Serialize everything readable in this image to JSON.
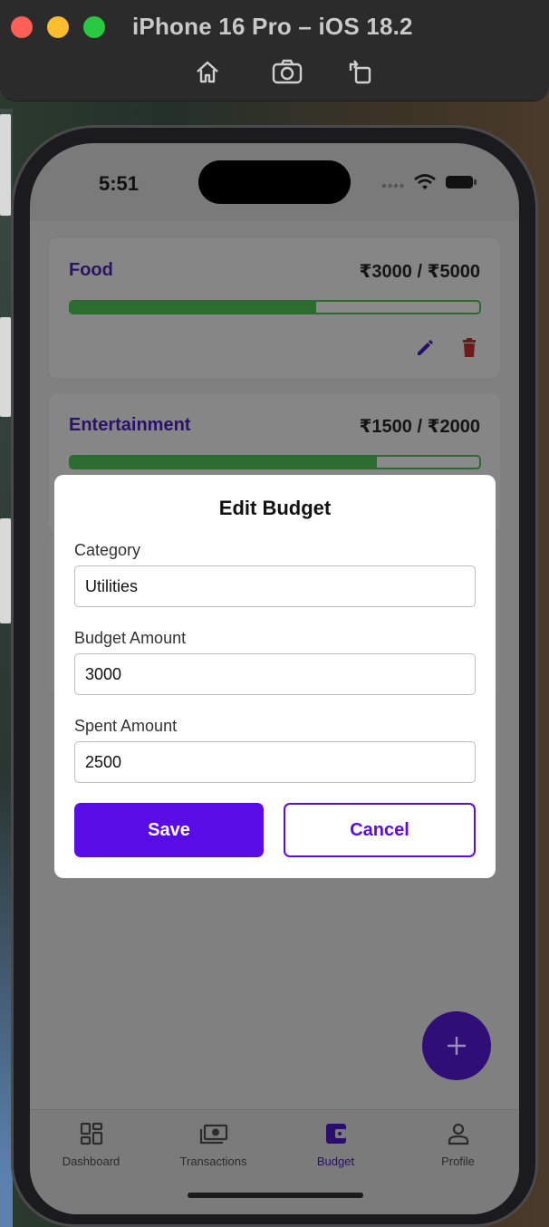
{
  "simulator": {
    "title": "iPhone 16 Pro – iOS 18.2",
    "toolbar": [
      "home-icon",
      "screenshot-icon",
      "rotate-icon"
    ]
  },
  "status_bar": {
    "time": "5:51"
  },
  "budgets": [
    {
      "category": "Food",
      "amount_text": "₹3000 / ₹5000",
      "spent": 3000,
      "budget": 5000,
      "progress": 0.6
    },
    {
      "category": "Entertainment",
      "amount_text": "₹1500 / ₹2000",
      "spent": 1500,
      "budget": 2000,
      "progress": 0.75
    }
  ],
  "modal": {
    "title": "Edit Budget",
    "category_label": "Category",
    "category_value": "Utilities",
    "budget_label": "Budget Amount",
    "budget_value": "3000",
    "spent_label": "Spent Amount",
    "spent_value": "2500",
    "save_label": "Save",
    "cancel_label": "Cancel"
  },
  "fab": {
    "label": "+"
  },
  "tabs": [
    {
      "label": "Dashboard",
      "icon": "dashboard-icon",
      "active": false
    },
    {
      "label": "Transactions",
      "icon": "cash-icon",
      "active": false
    },
    {
      "label": "Budget",
      "icon": "wallet-icon",
      "active": true
    },
    {
      "label": "Profile",
      "icon": "person-icon",
      "active": false
    }
  ],
  "colors": {
    "primary": "#5a0ce6",
    "progress_green": "#2c6c30",
    "delete_red": "#b0282a"
  }
}
